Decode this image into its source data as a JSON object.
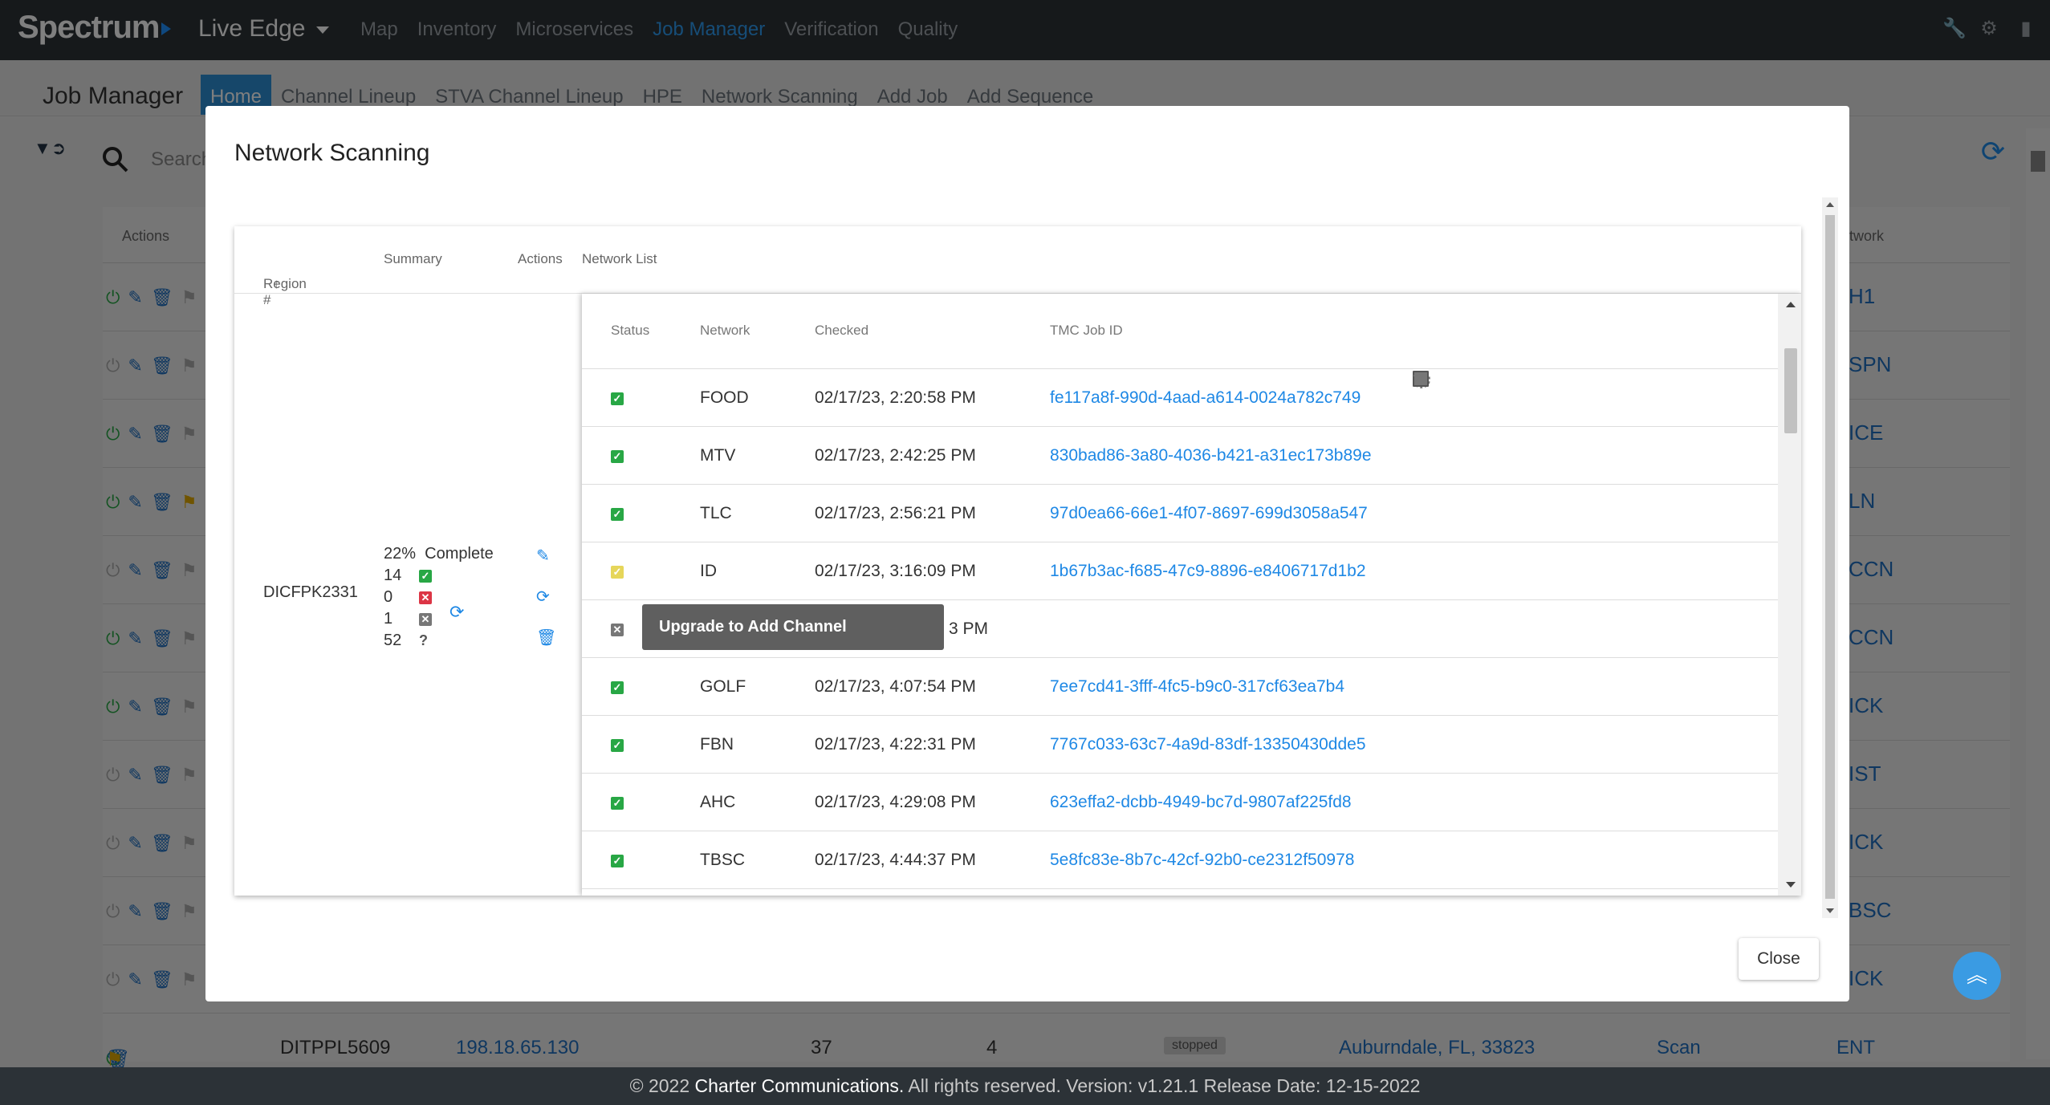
{
  "nav": {
    "brand": "Spectrum",
    "product": "Live Edge",
    "items": [
      "Map",
      "Inventory",
      "Microservices",
      "Job Manager",
      "Verification",
      "Quality"
    ],
    "active_item": "Job Manager"
  },
  "subnav": {
    "title": "Job Manager",
    "tabs": [
      "Home",
      "Channel Lineup",
      "STVA Channel Lineup",
      "HPE",
      "Network Scanning",
      "Add Job",
      "Add Sequence"
    ],
    "active_tab": "Home"
  },
  "background": {
    "search_placeholder": "Search",
    "actions_header": "Actions",
    "network_header": "twork",
    "network_values": [
      "H1",
      "SPN",
      "ICE",
      "LN",
      "CCN",
      "CCN",
      "ICK",
      "IST",
      "ICK",
      "BSC",
      "ICK"
    ],
    "last_row": {
      "region": "DITPPL5609",
      "ip": "198.18.65.130",
      "count_a": "37",
      "count_b": "4",
      "status": "stopped",
      "location": "Auburndale, FL, 33823",
      "action": "Scan",
      "network": "ENT"
    }
  },
  "modal": {
    "title": "Network Scanning",
    "close_label": "Close",
    "outer_headers": {
      "region": "Region #",
      "summary": "Summary",
      "actions": "Actions",
      "network_list": "Network List"
    },
    "region_id": "DICFPK2331",
    "summary": {
      "percent": "22%",
      "complete_label": "Complete",
      "success": "14",
      "failed": "0",
      "cancelled": "1",
      "unknown": "52"
    },
    "inner_headers": {
      "status": "Status",
      "network": "Network",
      "checked": "Checked",
      "job_id": "TMC Job ID"
    },
    "rows": [
      {
        "network": "FOOD",
        "checked": "02/17/23, 2:20:58 PM",
        "job_id": "fe117a8f-990d-4aad-a614-0024a782c749",
        "status": "success"
      },
      {
        "network": "MTV",
        "checked": "02/17/23, 2:42:25 PM",
        "job_id": "830bad86-3a80-4036-b421-a31ec173b89e",
        "status": "success"
      },
      {
        "network": "TLC",
        "checked": "02/17/23, 2:56:21 PM",
        "job_id": "97d0ea66-66e1-4f07-8697-699d3058a547",
        "status": "success"
      },
      {
        "network": "ID",
        "checked": "02/17/23, 3:16:09 PM",
        "job_id": "1b67b3ac-f685-47c9-8896-e8406717d1b2",
        "status": "pending"
      },
      {
        "network": "",
        "checked": "3 PM",
        "job_id": "",
        "status": "cancelled"
      },
      {
        "network": "GOLF",
        "checked": "02/17/23, 4:07:54 PM",
        "job_id": "7ee7cd41-3fff-4fc5-b9c0-317cf63ea7b4",
        "status": "success"
      },
      {
        "network": "FBN",
        "checked": "02/17/23, 4:22:31 PM",
        "job_id": "7767c033-63c7-4a9d-83df-13350430dde5",
        "status": "success"
      },
      {
        "network": "AHC",
        "checked": "02/17/23, 4:29:08 PM",
        "job_id": "623effa2-dcbb-4949-bc7d-9807af225fd8",
        "status": "success"
      },
      {
        "network": "TBSC",
        "checked": "02/17/23, 4:44:37 PM",
        "job_id": "5e8fc83e-8b7c-42cf-92b0-ce2312f50978",
        "status": "success"
      }
    ],
    "tooltip": "Upgrade to Add Channel"
  },
  "footer": {
    "copyright": "© 2022",
    "company": "Charter Communications.",
    "rest": "All rights reserved. Version: v1.21.1 Release Date: 12-15-2022"
  },
  "colors": {
    "success": "#28a745",
    "failed": "#dc3545",
    "cancelled": "#777777",
    "pending": "#e6d65a",
    "link": "#1e88e5",
    "nav_bg": "#2c3237",
    "active_tab": "#2d8fd5"
  }
}
